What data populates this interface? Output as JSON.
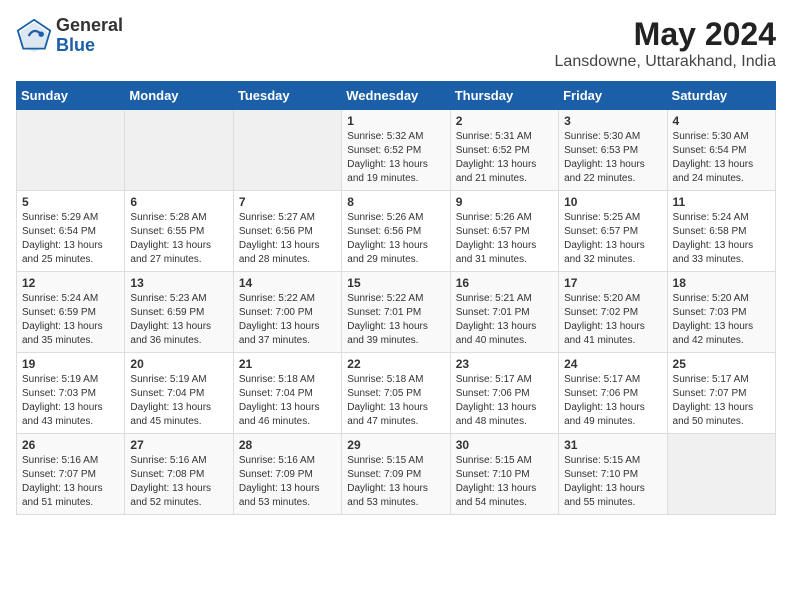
{
  "header": {
    "logo_general": "General",
    "logo_blue": "Blue",
    "title": "May 2024",
    "subtitle": "Lansdowne, Uttarakhand, India"
  },
  "days_of_week": [
    "Sunday",
    "Monday",
    "Tuesday",
    "Wednesday",
    "Thursday",
    "Friday",
    "Saturday"
  ],
  "weeks": [
    [
      {
        "day": "",
        "empty": true
      },
      {
        "day": "",
        "empty": true
      },
      {
        "day": "",
        "empty": true
      },
      {
        "day": "1",
        "sunrise": "5:32 AM",
        "sunset": "6:52 PM",
        "daylight": "13 hours and 19 minutes."
      },
      {
        "day": "2",
        "sunrise": "5:31 AM",
        "sunset": "6:52 PM",
        "daylight": "13 hours and 21 minutes."
      },
      {
        "day": "3",
        "sunrise": "5:30 AM",
        "sunset": "6:53 PM",
        "daylight": "13 hours and 22 minutes."
      },
      {
        "day": "4",
        "sunrise": "5:30 AM",
        "sunset": "6:54 PM",
        "daylight": "13 hours and 24 minutes."
      }
    ],
    [
      {
        "day": "5",
        "sunrise": "5:29 AM",
        "sunset": "6:54 PM",
        "daylight": "13 hours and 25 minutes."
      },
      {
        "day": "6",
        "sunrise": "5:28 AM",
        "sunset": "6:55 PM",
        "daylight": "13 hours and 27 minutes."
      },
      {
        "day": "7",
        "sunrise": "5:27 AM",
        "sunset": "6:56 PM",
        "daylight": "13 hours and 28 minutes."
      },
      {
        "day": "8",
        "sunrise": "5:26 AM",
        "sunset": "6:56 PM",
        "daylight": "13 hours and 29 minutes."
      },
      {
        "day": "9",
        "sunrise": "5:26 AM",
        "sunset": "6:57 PM",
        "daylight": "13 hours and 31 minutes."
      },
      {
        "day": "10",
        "sunrise": "5:25 AM",
        "sunset": "6:57 PM",
        "daylight": "13 hours and 32 minutes."
      },
      {
        "day": "11",
        "sunrise": "5:24 AM",
        "sunset": "6:58 PM",
        "daylight": "13 hours and 33 minutes."
      }
    ],
    [
      {
        "day": "12",
        "sunrise": "5:24 AM",
        "sunset": "6:59 PM",
        "daylight": "13 hours and 35 minutes."
      },
      {
        "day": "13",
        "sunrise": "5:23 AM",
        "sunset": "6:59 PM",
        "daylight": "13 hours and 36 minutes."
      },
      {
        "day": "14",
        "sunrise": "5:22 AM",
        "sunset": "7:00 PM",
        "daylight": "13 hours and 37 minutes."
      },
      {
        "day": "15",
        "sunrise": "5:22 AM",
        "sunset": "7:01 PM",
        "daylight": "13 hours and 39 minutes."
      },
      {
        "day": "16",
        "sunrise": "5:21 AM",
        "sunset": "7:01 PM",
        "daylight": "13 hours and 40 minutes."
      },
      {
        "day": "17",
        "sunrise": "5:20 AM",
        "sunset": "7:02 PM",
        "daylight": "13 hours and 41 minutes."
      },
      {
        "day": "18",
        "sunrise": "5:20 AM",
        "sunset": "7:03 PM",
        "daylight": "13 hours and 42 minutes."
      }
    ],
    [
      {
        "day": "19",
        "sunrise": "5:19 AM",
        "sunset": "7:03 PM",
        "daylight": "13 hours and 43 minutes."
      },
      {
        "day": "20",
        "sunrise": "5:19 AM",
        "sunset": "7:04 PM",
        "daylight": "13 hours and 45 minutes."
      },
      {
        "day": "21",
        "sunrise": "5:18 AM",
        "sunset": "7:04 PM",
        "daylight": "13 hours and 46 minutes."
      },
      {
        "day": "22",
        "sunrise": "5:18 AM",
        "sunset": "7:05 PM",
        "daylight": "13 hours and 47 minutes."
      },
      {
        "day": "23",
        "sunrise": "5:17 AM",
        "sunset": "7:06 PM",
        "daylight": "13 hours and 48 minutes."
      },
      {
        "day": "24",
        "sunrise": "5:17 AM",
        "sunset": "7:06 PM",
        "daylight": "13 hours and 49 minutes."
      },
      {
        "day": "25",
        "sunrise": "5:17 AM",
        "sunset": "7:07 PM",
        "daylight": "13 hours and 50 minutes."
      }
    ],
    [
      {
        "day": "26",
        "sunrise": "5:16 AM",
        "sunset": "7:07 PM",
        "daylight": "13 hours and 51 minutes."
      },
      {
        "day": "27",
        "sunrise": "5:16 AM",
        "sunset": "7:08 PM",
        "daylight": "13 hours and 52 minutes."
      },
      {
        "day": "28",
        "sunrise": "5:16 AM",
        "sunset": "7:09 PM",
        "daylight": "13 hours and 53 minutes."
      },
      {
        "day": "29",
        "sunrise": "5:15 AM",
        "sunset": "7:09 PM",
        "daylight": "13 hours and 53 minutes."
      },
      {
        "day": "30",
        "sunrise": "5:15 AM",
        "sunset": "7:10 PM",
        "daylight": "13 hours and 54 minutes."
      },
      {
        "day": "31",
        "sunrise": "5:15 AM",
        "sunset": "7:10 PM",
        "daylight": "13 hours and 55 minutes."
      },
      {
        "day": "",
        "empty": true
      }
    ]
  ]
}
